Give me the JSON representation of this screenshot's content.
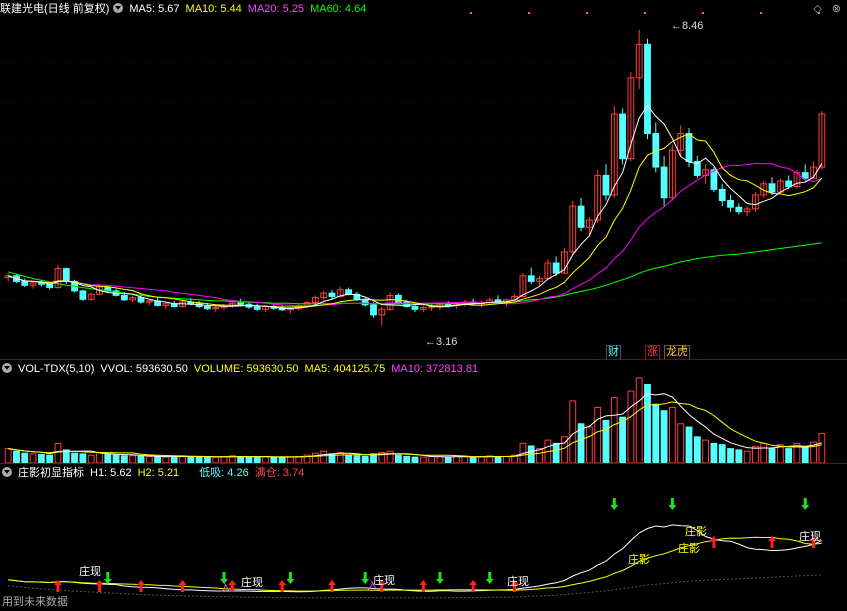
{
  "kline": {
    "title": "联建光电(日线 前复权)",
    "ma5_label": "MA5: 5.67",
    "ma10_label": "MA10: 5.44",
    "ma20_label": "MA20: 5.25",
    "ma60_label": "MA60: 4.64",
    "high_label": "8.46",
    "low_label": "3.16",
    "events": [
      "财",
      "涨",
      "龙虎"
    ],
    "colors": {
      "ma5": "#ffffff",
      "ma10": "#ffff00",
      "ma20": "#ff00ff",
      "ma60": "#00ff00",
      "up": "#ff3b3b",
      "down": "#54ffff"
    }
  },
  "volume": {
    "title": "VOL-TDX(5,10)",
    "vvol": "VVOL: 593630.50",
    "volume": "VOLUME: 593630.50",
    "ma5": "MA5: 404125.75",
    "ma10": "MA10: 372813.81"
  },
  "indicator": {
    "title": "庄影初显指标",
    "h1": "H1: 5.62",
    "h2": "H2: 5.21",
    "dixi": "低吸: 4.26",
    "mancang": "满仓: 3.74",
    "zhuang_xian": "庄现",
    "zhuang_ying": "庄影",
    "ru": "入"
  },
  "toolbar": {
    "diamond_icon": "◇",
    "close_icon": "⊗"
  },
  "footer": {
    "text": "用到未来数据"
  },
  "chart_data": {
    "type": "candlestick",
    "ylim": [
      2.9,
      8.6
    ],
    "candles": [
      [
        4.02,
        4.1,
        3.95,
        4.05
      ],
      [
        4.05,
        4.08,
        3.92,
        3.95
      ],
      [
        3.95,
        4.0,
        3.85,
        3.88
      ],
      [
        3.88,
        3.95,
        3.82,
        3.92
      ],
      [
        3.92,
        3.98,
        3.86,
        3.9
      ],
      [
        3.9,
        3.95,
        3.8,
        3.84
      ],
      [
        3.84,
        4.25,
        3.82,
        4.18
      ],
      [
        4.18,
        4.2,
        3.9,
        3.95
      ],
      [
        3.95,
        3.98,
        3.75,
        3.78
      ],
      [
        3.78,
        3.8,
        3.6,
        3.63
      ],
      [
        3.63,
        3.75,
        3.6,
        3.72
      ],
      [
        3.72,
        3.9,
        3.7,
        3.85
      ],
      [
        3.85,
        3.88,
        3.75,
        3.78
      ],
      [
        3.78,
        3.82,
        3.68,
        3.7
      ],
      [
        3.7,
        3.76,
        3.6,
        3.62
      ],
      [
        3.62,
        3.7,
        3.58,
        3.66
      ],
      [
        3.66,
        3.72,
        3.55,
        3.58
      ],
      [
        3.58,
        3.64,
        3.52,
        3.6
      ],
      [
        3.6,
        3.66,
        3.5,
        3.52
      ],
      [
        3.52,
        3.58,
        3.45,
        3.55
      ],
      [
        3.55,
        3.6,
        3.48,
        3.5
      ],
      [
        3.5,
        3.62,
        3.48,
        3.58
      ],
      [
        3.58,
        3.65,
        3.52,
        3.55
      ],
      [
        3.55,
        3.6,
        3.47,
        3.5
      ],
      [
        3.5,
        3.56,
        3.44,
        3.46
      ],
      [
        3.46,
        3.52,
        3.4,
        3.48
      ],
      [
        3.48,
        3.55,
        3.44,
        3.52
      ],
      [
        3.52,
        3.6,
        3.48,
        3.56
      ],
      [
        3.56,
        3.64,
        3.5,
        3.54
      ],
      [
        3.54,
        3.58,
        3.46,
        3.49
      ],
      [
        3.49,
        3.55,
        3.42,
        3.45
      ],
      [
        3.45,
        3.52,
        3.4,
        3.5
      ],
      [
        3.5,
        3.56,
        3.44,
        3.47
      ],
      [
        3.47,
        3.53,
        3.42,
        3.44
      ],
      [
        3.44,
        3.5,
        3.38,
        3.46
      ],
      [
        3.46,
        3.54,
        3.43,
        3.52
      ],
      [
        3.52,
        3.6,
        3.47,
        3.57
      ],
      [
        3.57,
        3.7,
        3.54,
        3.66
      ],
      [
        3.66,
        3.78,
        3.62,
        3.74
      ],
      [
        3.74,
        3.8,
        3.64,
        3.68
      ],
      [
        3.68,
        3.86,
        3.66,
        3.8
      ],
      [
        3.8,
        3.84,
        3.7,
        3.72
      ],
      [
        3.72,
        3.76,
        3.6,
        3.62
      ],
      [
        3.62,
        3.66,
        3.5,
        3.53
      ],
      [
        3.53,
        3.58,
        3.3,
        3.35
      ],
      [
        3.35,
        3.5,
        3.16,
        3.45
      ],
      [
        3.45,
        3.75,
        3.42,
        3.7
      ],
      [
        3.7,
        3.74,
        3.56,
        3.58
      ],
      [
        3.58,
        3.62,
        3.48,
        3.5
      ],
      [
        3.5,
        3.55,
        3.4,
        3.45
      ],
      [
        3.45,
        3.52,
        3.4,
        3.48
      ],
      [
        3.48,
        3.55,
        3.42,
        3.5
      ],
      [
        3.5,
        3.56,
        3.44,
        3.54
      ],
      [
        3.54,
        3.6,
        3.48,
        3.52
      ],
      [
        3.52,
        3.58,
        3.46,
        3.55
      ],
      [
        3.55,
        3.62,
        3.5,
        3.58
      ],
      [
        3.58,
        3.64,
        3.52,
        3.55
      ],
      [
        3.55,
        3.6,
        3.48,
        3.57
      ],
      [
        3.57,
        3.66,
        3.54,
        3.62
      ],
      [
        3.62,
        3.7,
        3.56,
        3.58
      ],
      [
        3.58,
        3.64,
        3.5,
        3.62
      ],
      [
        3.62,
        3.72,
        3.58,
        3.68
      ],
      [
        3.68,
        4.1,
        3.66,
        4.05
      ],
      [
        4.05,
        4.2,
        3.9,
        3.95
      ],
      [
        3.95,
        4.05,
        3.88,
        4.0
      ],
      [
        4.0,
        4.35,
        3.98,
        4.28
      ],
      [
        4.28,
        4.4,
        4.05,
        4.1
      ],
      [
        4.1,
        4.55,
        4.08,
        4.48
      ],
      [
        4.48,
        5.4,
        4.45,
        5.3
      ],
      [
        5.3,
        5.45,
        4.85,
        4.92
      ],
      [
        4.92,
        5.1,
        4.75,
        5.05
      ],
      [
        5.05,
        5.95,
        5.0,
        5.85
      ],
      [
        5.85,
        6.05,
        5.4,
        5.5
      ],
      [
        5.5,
        7.1,
        5.45,
        6.95
      ],
      [
        6.95,
        7.05,
        6.05,
        6.15
      ],
      [
        6.15,
        7.7,
        6.1,
        7.6
      ],
      [
        7.6,
        8.46,
        7.4,
        8.2
      ],
      [
        8.2,
        8.3,
        6.5,
        6.6
      ],
      [
        6.6,
        6.8,
        5.9,
        6.0
      ],
      [
        6.0,
        6.2,
        5.3,
        5.45
      ],
      [
        5.45,
        6.4,
        5.4,
        6.3
      ],
      [
        6.3,
        6.75,
        6.2,
        6.6
      ],
      [
        6.6,
        6.7,
        6.0,
        6.1
      ],
      [
        6.1,
        6.2,
        5.8,
        5.85
      ],
      [
        5.85,
        6.05,
        5.7,
        5.95
      ],
      [
        5.95,
        6.0,
        5.55,
        5.6
      ],
      [
        5.6,
        5.7,
        5.3,
        5.4
      ],
      [
        5.4,
        5.5,
        5.2,
        5.28
      ],
      [
        5.28,
        5.35,
        5.15,
        5.2
      ],
      [
        5.2,
        5.3,
        5.12,
        5.25
      ],
      [
        5.25,
        5.55,
        5.2,
        5.5
      ],
      [
        5.5,
        5.75,
        5.45,
        5.7
      ],
      [
        5.7,
        5.82,
        5.5,
        5.55
      ],
      [
        5.55,
        5.8,
        5.52,
        5.75
      ],
      [
        5.75,
        5.85,
        5.6,
        5.65
      ],
      [
        5.65,
        5.95,
        5.62,
        5.9
      ],
      [
        5.9,
        6.05,
        5.75,
        5.8
      ],
      [
        5.8,
        6.1,
        5.78,
        6.0
      ],
      [
        6.0,
        7.0,
        5.95,
        6.95
      ]
    ],
    "ma60": [
      4.12,
      4.08,
      4.04,
      4.0,
      3.97,
      3.94,
      3.91,
      3.88,
      3.86,
      3.84,
      3.82,
      3.8,
      3.78,
      3.76,
      3.74,
      3.72,
      3.7,
      3.68,
      3.67,
      3.66,
      3.65,
      3.64,
      3.63,
      3.62,
      3.61,
      3.6,
      3.6,
      3.59,
      3.58,
      3.58,
      3.57,
      3.57,
      3.56,
      3.56,
      3.56,
      3.55,
      3.55,
      3.55,
      3.55,
      3.55,
      3.56,
      3.56,
      3.56,
      3.56,
      3.55,
      3.55,
      3.55,
      3.55,
      3.55,
      3.55,
      3.55,
      3.55,
      3.55,
      3.55,
      3.56,
      3.56,
      3.56,
      3.56,
      3.57,
      3.57,
      3.57,
      3.58,
      3.6,
      3.62,
      3.63,
      3.65,
      3.67,
      3.7,
      3.74,
      3.77,
      3.8,
      3.84,
      3.88,
      3.93,
      3.98,
      4.03,
      4.1,
      4.15,
      4.19,
      4.22,
      4.26,
      4.3,
      4.33,
      4.36,
      4.38,
      4.4,
      4.42,
      4.43,
      4.44,
      4.46,
      4.48,
      4.5,
      4.52,
      4.54,
      4.56,
      4.58,
      4.6,
      4.62,
      4.64
    ],
    "volumes": [
      22,
      18,
      15,
      14,
      13,
      12,
      30,
      20,
      15,
      14,
      12,
      16,
      13,
      12,
      11,
      11,
      10,
      10,
      10,
      9,
      10,
      11,
      10,
      9,
      9,
      9,
      10,
      11,
      10,
      9,
      9,
      10,
      9,
      9,
      9,
      10,
      12,
      15,
      18,
      14,
      16,
      12,
      11,
      10,
      14,
      16,
      18,
      12,
      10,
      9,
      9,
      10,
      10,
      9,
      10,
      10,
      9,
      10,
      11,
      10,
      10,
      12,
      30,
      26,
      22,
      35,
      30,
      40,
      95,
      60,
      55,
      85,
      65,
      100,
      70,
      110,
      130,
      120,
      90,
      80,
      85,
      60,
      55,
      40,
      35,
      30,
      28,
      22,
      20,
      18,
      25,
      30,
      22,
      28,
      22,
      30,
      25,
      32,
      45
    ],
    "vol_ylim": [
      0,
      130
    ],
    "ind_h1": [
      5.62
    ],
    "ind_h2": [
      5.21
    ]
  }
}
